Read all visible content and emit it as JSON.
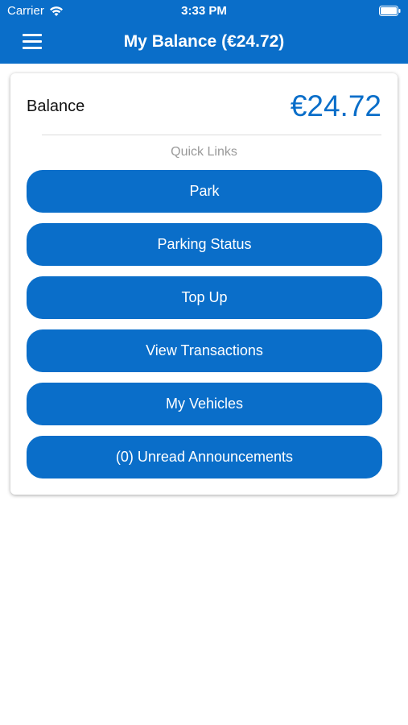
{
  "status_bar": {
    "carrier": "Carrier",
    "time": "3:33 PM",
    "icons": [
      "wifi-icon",
      "battery-icon"
    ]
  },
  "nav": {
    "title": "My Balance (€24.72)",
    "menu_icon": "menu-icon"
  },
  "balance": {
    "label": "Balance",
    "value": "€24.72"
  },
  "quick_links": {
    "heading": "Quick Links",
    "buttons": [
      "Park",
      "Parking Status",
      "Top Up",
      "View Transactions",
      "My Vehicles",
      "(0) Unread Announcements"
    ]
  },
  "colors": {
    "primary": "#0a6ec9",
    "text": "#111111",
    "muted": "#9a9a9a",
    "background": "#ffffff"
  }
}
